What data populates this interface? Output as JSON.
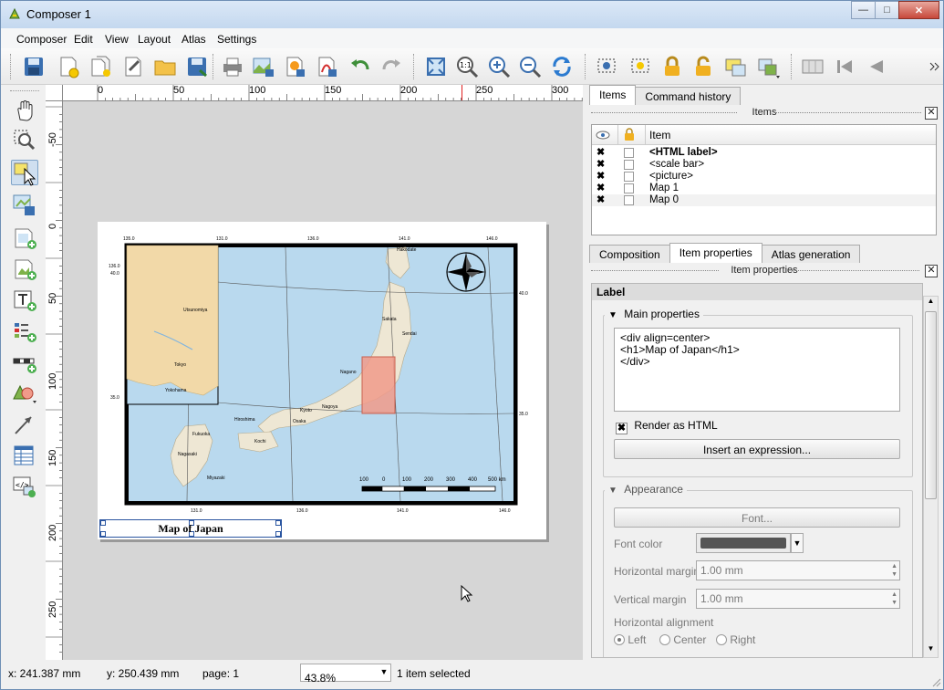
{
  "window": {
    "title": "Composer 1"
  },
  "menu": [
    "Composer",
    "Edit",
    "View",
    "Layout",
    "Atlas",
    "Settings"
  ],
  "ruler": {
    "h_labels": [
      "0",
      "50",
      "100",
      "150",
      "200",
      "250",
      "300"
    ],
    "v_labels": [
      "-50",
      "0",
      "50",
      "100",
      "150",
      "200",
      "250"
    ]
  },
  "map": {
    "top_ticks": [
      "135.0",
      "131.0",
      "136.0",
      "141.0",
      "146.0"
    ],
    "bottom_ticks": [
      "131.0",
      "136.0",
      "141.0",
      "146.0"
    ],
    "right_ticks": [
      "40.0",
      "35.0"
    ],
    "inset_ticks": [
      "136.0",
      "40.0",
      "35.0"
    ],
    "cities": [
      "Hakodate",
      "Sakata",
      "Sendai",
      "Nagano",
      "Nagoya",
      "Hiroshima",
      "Kyoto",
      "Osaka",
      "Kochi",
      "Fukuoka",
      "Nagasaki",
      "Miyazaki",
      "Tokyo",
      "Yokohama",
      "Utsunomiya"
    ],
    "scale_labels": [
      "100",
      "0",
      "100",
      "200",
      "300",
      "400",
      "500 km"
    ],
    "label_text": "Map of Japan"
  },
  "panel": {
    "top_tabs": [
      "Items",
      "Command history"
    ],
    "items_title": "Items",
    "items_header": "Item",
    "items": [
      "<HTML label>",
      "<scale bar>",
      "<picture>",
      "Map 1",
      "Map 0"
    ],
    "bottom_tabs": [
      "Composition",
      "Item properties",
      "Atlas generation"
    ],
    "props_title": "Item properties",
    "section_label": "Label",
    "main_props": "Main properties",
    "html_lines": [
      "<div align=center>",
      "<h1>Map of Japan</h1>",
      "</div>"
    ],
    "render_html": "Render as HTML",
    "insert_expr": "Insert an expression...",
    "appearance": "Appearance",
    "font_btn": "Font...",
    "font_color": "Font color",
    "hmargin_label": "Horizontal margin",
    "hmargin_val": "1.00 mm",
    "vmargin_label": "Vertical margin",
    "vmargin_val": "1.00 mm",
    "halign": "Horizontal alignment",
    "halign_opts": [
      "Left",
      "Center",
      "Right"
    ]
  },
  "status": {
    "x": "x: 241.387 mm",
    "y": "y: 250.439 mm",
    "page": "page: 1",
    "zoom": "43.8%",
    "selection": "1 item selected"
  },
  "colors": {
    "sea": "#b9d9ee",
    "land": "#eee7d4",
    "highlight": "#f09a8a"
  }
}
